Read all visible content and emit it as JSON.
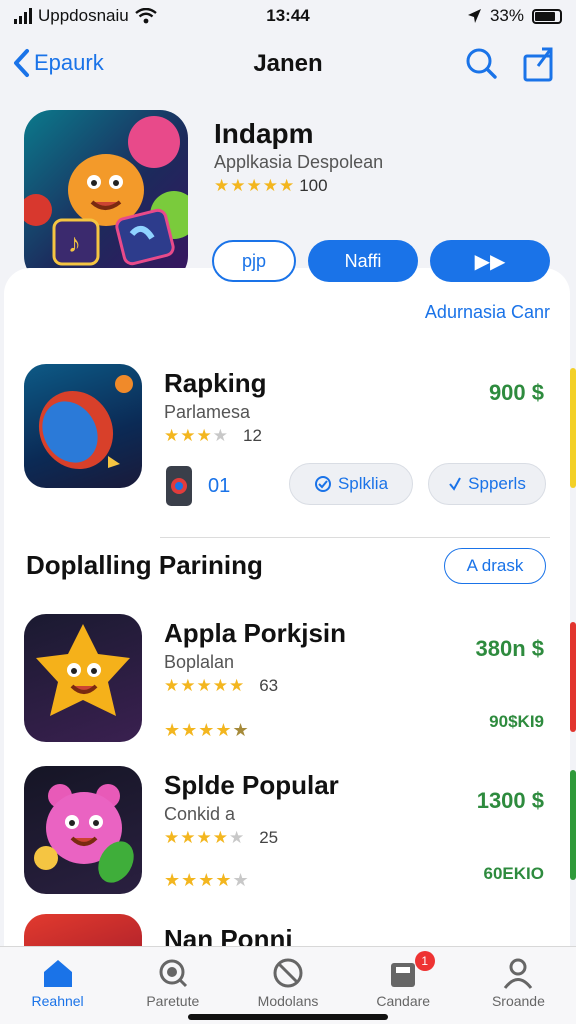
{
  "status": {
    "carrier": "Uppdosnaiu",
    "time": "13:44",
    "battery": "33%"
  },
  "nav": {
    "back_label": "Epaurk",
    "title": "Janen"
  },
  "hero": {
    "title": "Indapm",
    "subtitle": "Applkasia Despolean",
    "rating_value": "100",
    "buttons": {
      "b1": "pjp",
      "b2": "Naffi",
      "b3": "▶▶"
    }
  },
  "link_right": "Adurnasia Canr",
  "featured": {
    "title": "Rapking",
    "subtitle": "Parlamesa",
    "rating_count": "12",
    "price": "900 $",
    "small_count": "01",
    "btn1": "Splklia",
    "btn2": "Spperls"
  },
  "section": {
    "title": "Doplalling Parining",
    "action": "A drask"
  },
  "list": [
    {
      "title": "Appla Porkjsin",
      "subtitle": "Boplalan",
      "rating_count": "63",
      "price": "380n $",
      "price2": "90$KI9"
    },
    {
      "title": "Splde Popular",
      "subtitle": "Conkid a",
      "rating_count": "25",
      "price": "1300 $",
      "price2": "60EKIO"
    },
    {
      "title": "Nan Ponni"
    }
  ],
  "tabs": [
    {
      "label": "Reahnel",
      "icon": "home-icon"
    },
    {
      "label": "Paretute",
      "icon": "search-icon"
    },
    {
      "label": "Modolans",
      "icon": "block-icon"
    },
    {
      "label": "Candare",
      "icon": "inbox-icon",
      "badge": "1"
    },
    {
      "label": "Sroande",
      "icon": "person-icon"
    }
  ],
  "colors": {
    "accent": "#1a73e8",
    "price": "#2e8b3e",
    "star": "#f3b61f"
  }
}
